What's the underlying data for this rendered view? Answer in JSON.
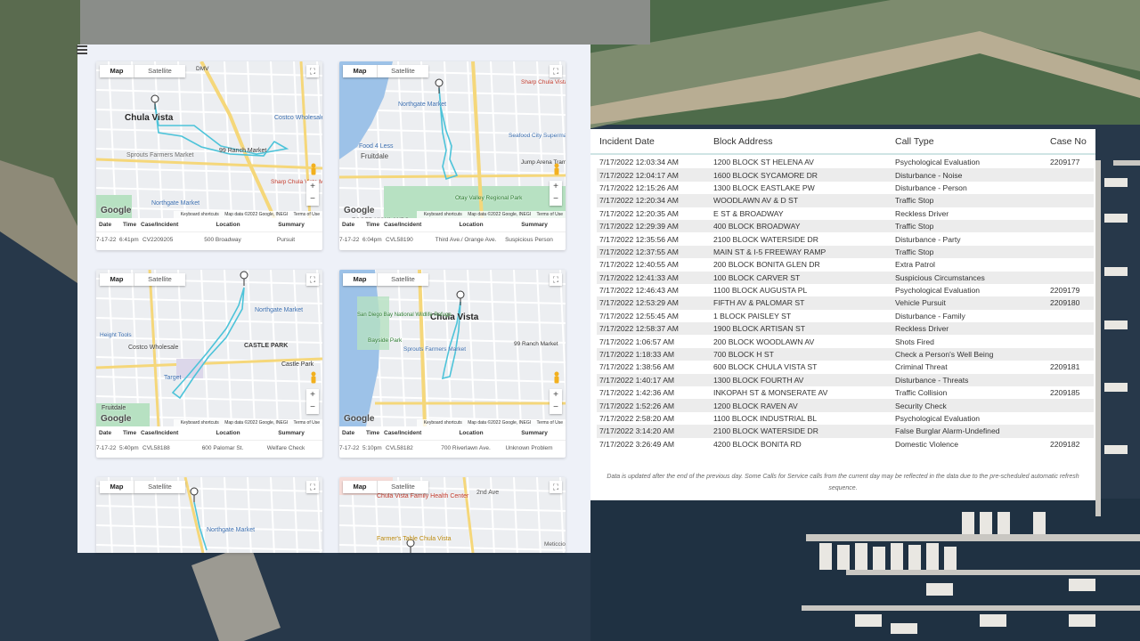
{
  "map_controls": {
    "map_label": "Map",
    "satellite_label": "Satellite",
    "google_logo": "Google",
    "keyboard_shortcuts": "Keyboard shortcuts",
    "map_data": "Map data ©2022 Google, INEGI",
    "terms": "Terms of Use",
    "zoom_in": "+",
    "zoom_out": "−",
    "fullscreen": "⛶"
  },
  "incident_columns": {
    "date": "Date",
    "time": "Time",
    "case": "Case/Incident",
    "location": "Location",
    "summary": "Summary"
  },
  "cards": [
    {
      "map_labels": [
        "Chula Vista",
        "Costco Wholesale",
        "99 Ranch Market",
        "Sprouts Farmers Market",
        "Northgate Market",
        "Sharp Chula Vista Medical Center",
        "DMV"
      ],
      "incident": {
        "date": "7-17-22",
        "time": "6:41pm",
        "case": "CV2209205",
        "location": "500 Broadway",
        "summary": "Pursuit"
      }
    },
    {
      "map_labels": [
        "Northgate Market",
        "Food 4 Less",
        "Seafood City Supermarket",
        "Jump Arena Trampoline",
        "Fruitdale",
        "Otay Valley Regional Park",
        "EGGER HIGHLANDS",
        "Sharp Chula Vista Medical Center"
      ],
      "incident": {
        "date": "7-17-22",
        "time": "6:04pm",
        "case": "CVL58190",
        "location": "Third Ave./ Orange Ave.",
        "summary": "Suspicious Person"
      }
    },
    {
      "map_labels": [
        "Northgate Market",
        "Costco Wholesale",
        "Target",
        "CASTLE PARK",
        "Castle Park",
        "Fruitdale",
        "Height Tools"
      ],
      "incident": {
        "date": "7-17-22",
        "time": "5:40pm",
        "case": "CVL58188",
        "location": "600 Palomar St.",
        "summary": "Welfare Check"
      }
    },
    {
      "map_labels": [
        "Chula Vista",
        "San Diego Bay National Wildlife Refuge",
        "Bayside Park",
        "Sprouts Farmers Market",
        "99 Ranch Market"
      ],
      "incident": {
        "date": "7-17-22",
        "time": "5:10pm",
        "case": "CVL58182",
        "location": "700 Riverlawn Ave.",
        "summary": "Unknown Problem"
      }
    },
    {
      "map_labels": [
        "Northgate Market"
      ]
    },
    {
      "map_labels": [
        "Chula Vista Family Health Center",
        "Farmer's Table Chula Vista",
        "2nd Ave",
        "Meticcio"
      ]
    }
  ],
  "calls_table": {
    "columns": {
      "incident_date": "Incident Date",
      "block_address": "Block Address",
      "call_type": "Call Type",
      "case_no": "Case No"
    },
    "rows": [
      {
        "date": "7/17/2022 12:03:34 AM",
        "address": "1200 BLOCK ST HELENA AV",
        "type": "Psychological Evaluation",
        "case": "2209177"
      },
      {
        "date": "7/17/2022 12:04:17 AM",
        "address": "1600 BLOCK SYCAMORE DR",
        "type": "Disturbance - Noise",
        "case": ""
      },
      {
        "date": "7/17/2022 12:15:26 AM",
        "address": "1300 BLOCK EASTLAKE PW",
        "type": "Disturbance - Person",
        "case": ""
      },
      {
        "date": "7/17/2022 12:20:34 AM",
        "address": "WOODLAWN AV & D ST",
        "type": "Traffic Stop",
        "case": ""
      },
      {
        "date": "7/17/2022 12:20:35 AM",
        "address": "E ST & BROADWAY",
        "type": "Reckless Driver",
        "case": ""
      },
      {
        "date": "7/17/2022 12:29:39 AM",
        "address": "400 BLOCK BROADWAY",
        "type": "Traffic Stop",
        "case": ""
      },
      {
        "date": "7/17/2022 12:35:56 AM",
        "address": "2100 BLOCK WATERSIDE DR",
        "type": "Disturbance - Party",
        "case": ""
      },
      {
        "date": "7/17/2022 12:37:55 AM",
        "address": "MAIN ST & I-5 FREEWAY RAMP",
        "type": "Traffic Stop",
        "case": ""
      },
      {
        "date": "7/17/2022 12:40:55 AM",
        "address": "200 BLOCK BONITA GLEN DR",
        "type": "Extra Patrol",
        "case": ""
      },
      {
        "date": "7/17/2022 12:41:33 AM",
        "address": "100 BLOCK CARVER ST",
        "type": "Suspicious Circumstances",
        "case": ""
      },
      {
        "date": "7/17/2022 12:46:43 AM",
        "address": "1100 BLOCK AUGUSTA PL",
        "type": "Psychological Evaluation",
        "case": "2209179"
      },
      {
        "date": "7/17/2022 12:53:29 AM",
        "address": "FIFTH AV & PALOMAR ST",
        "type": "Vehicle Pursuit",
        "case": "2209180"
      },
      {
        "date": "7/17/2022 12:55:45 AM",
        "address": "1 BLOCK PAISLEY ST",
        "type": "Disturbance - Family",
        "case": ""
      },
      {
        "date": "7/17/2022 12:58:37 AM",
        "address": "1900 BLOCK ARTISAN ST",
        "type": "Reckless Driver",
        "case": ""
      },
      {
        "date": "7/17/2022 1:06:57 AM",
        "address": "200 BLOCK WOODLAWN AV",
        "type": "Shots Fired",
        "case": ""
      },
      {
        "date": "7/17/2022 1:18:33 AM",
        "address": "700 BLOCK H ST",
        "type": "Check a Person's Well Being",
        "case": ""
      },
      {
        "date": "7/17/2022 1:38:56 AM",
        "address": "600 BLOCK CHULA VISTA ST",
        "type": "Criminal Threat",
        "case": "2209181"
      },
      {
        "date": "7/17/2022 1:40:17 AM",
        "address": "1300 BLOCK FOURTH AV",
        "type": "Disturbance - Threats",
        "case": ""
      },
      {
        "date": "7/17/2022 1:42:36 AM",
        "address": "INKOPAH ST & MONSERATE AV",
        "type": "Traffic Collision",
        "case": "2209185"
      },
      {
        "date": "7/17/2022 1:52:26 AM",
        "address": "1200 BLOCK RAVEN AV",
        "type": "Security Check",
        "case": ""
      },
      {
        "date": "7/17/2022 2:58:20 AM",
        "address": "1100 BLOCK INDUSTRIAL BL",
        "type": "Psychological Evaluation",
        "case": ""
      },
      {
        "date": "7/17/2022 3:14:20 AM",
        "address": "2100 BLOCK WATERSIDE DR",
        "type": "False Burglar Alarm-Undefined",
        "case": ""
      },
      {
        "date": "7/17/2022 3:26:49 AM",
        "address": "4200 BLOCK BONITA RD",
        "type": "Domestic Violence",
        "case": "2209182"
      }
    ],
    "footnote": "Data is updated after the end of the previous day. Some Calls for Service calls from the current day may be reflected in the data due to the pre-scheduled automatic refresh sequence."
  },
  "colors": {
    "route": "#4cc3d9",
    "panel_bg": "#eef1f8",
    "water": "#9dc2e8",
    "park": "#b7e1c2",
    "road_major": "#f5d77a",
    "road": "#ffffff"
  }
}
